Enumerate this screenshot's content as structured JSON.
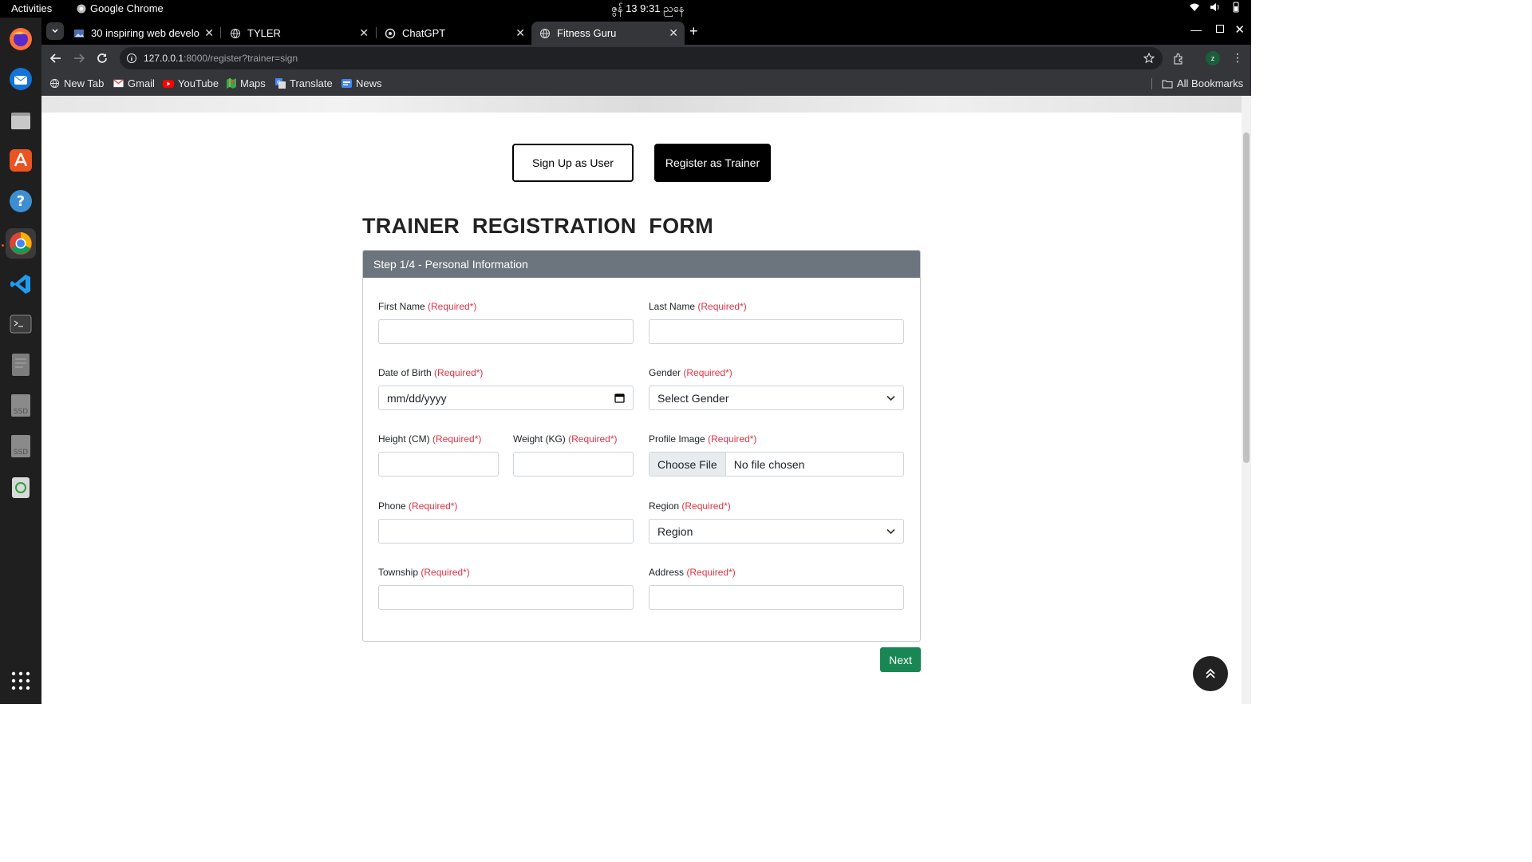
{
  "system": {
    "activities": "Activities",
    "app_name": "Google Chrome",
    "clock": "ဇွန် 13   9:31 ညနေ"
  },
  "tabs": [
    {
      "title": "30 inspiring web develo",
      "icon": "image-favicon-icon"
    },
    {
      "title": "TYLER",
      "icon": "globe-icon"
    },
    {
      "title": "ChatGPT",
      "icon": "chatgpt-icon"
    },
    {
      "title": "Fitness Guru",
      "icon": "globe-icon",
      "active": true
    }
  ],
  "address_bar": {
    "host": "127.0.0.1",
    "rest": ":8000/register?trainer=sign"
  },
  "bookmarks": [
    {
      "label": "New Tab",
      "icon": "globe-icon"
    },
    {
      "label": "Gmail",
      "icon": "gmail-icon"
    },
    {
      "label": "YouTube",
      "icon": "youtube-icon"
    },
    {
      "label": "Maps",
      "icon": "maps-icon"
    },
    {
      "label": "Translate",
      "icon": "translate-icon"
    },
    {
      "label": "News",
      "icon": "news-icon"
    }
  ],
  "all_bookmarks": "All Bookmarks",
  "profile_initial": "z",
  "page": {
    "btn_user": "Sign Up as User",
    "btn_trainer": "Register as Trainer",
    "title": "TRAINER  REGISTRATION  FORM",
    "step_header": "Step 1/4 - Personal Information",
    "required": "(Required*)",
    "fields": {
      "first_name": "First Name",
      "last_name": "Last Name",
      "dob": "Date of Birth",
      "dob_placeholder": "mm/dd/yyyy",
      "gender": "Gender",
      "gender_selected": "Select Gender",
      "height": "Height (CM)",
      "weight": "Weight (KG)",
      "profile_image": "Profile Image",
      "choose_file": "Choose File",
      "no_file": "No file chosen",
      "phone": "Phone",
      "region": "Region",
      "region_selected": "Region",
      "township": "Township",
      "address": "Address"
    },
    "next": "Next"
  },
  "colors": {
    "header_gray": "#6c757d",
    "required_red": "#dc3545",
    "next_green": "#198754"
  }
}
